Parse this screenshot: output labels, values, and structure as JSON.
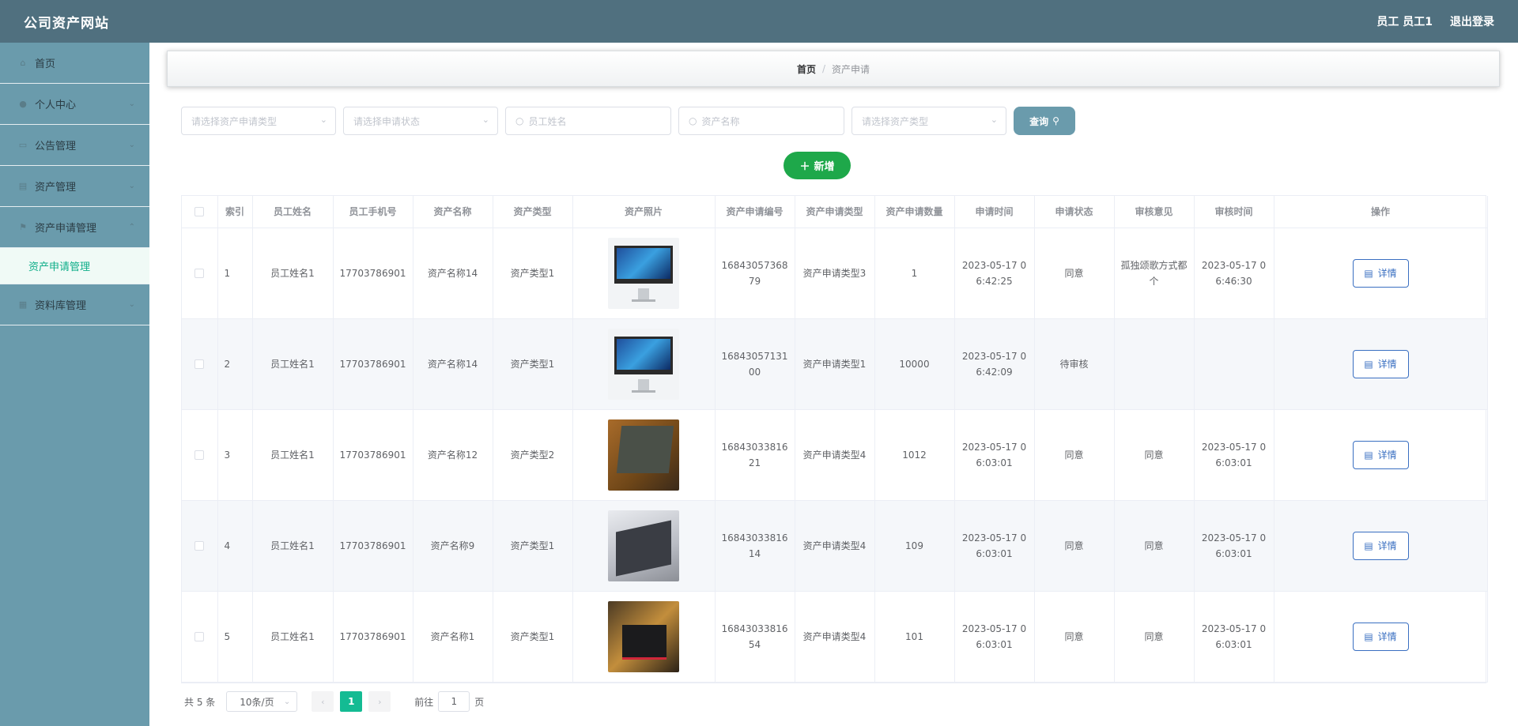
{
  "app": {
    "title": "公司资产网站",
    "user_label": "员工 员工1",
    "logout_label": "退出登录"
  },
  "sidebar": {
    "items": [
      {
        "label": "首页",
        "icon": "home-icon"
      },
      {
        "label": "个人中心",
        "icon": "user-icon"
      },
      {
        "label": "公告管理",
        "icon": "notice-icon"
      },
      {
        "label": "资产管理",
        "icon": "asset-icon"
      },
      {
        "label": "资产申请管理",
        "icon": "apply-icon",
        "expanded": true
      },
      {
        "label": "资料库管理",
        "icon": "library-icon"
      }
    ],
    "submenu_active": "资产申请管理"
  },
  "breadcrumb": {
    "home": "首页",
    "separator": "/",
    "current": "资产申请"
  },
  "filters": {
    "apply_type_placeholder": "请选择资产申请类型",
    "apply_status_placeholder": "请选择申请状态",
    "employee_name_placeholder": "员工姓名",
    "asset_name_placeholder": "资产名称",
    "asset_type_placeholder": "请选择资产类型",
    "query_label": "查询"
  },
  "add_label": "新增",
  "table": {
    "headers": [
      "索引",
      "员工姓名",
      "员工手机号",
      "资产名称",
      "资产类型",
      "资产照片",
      "资产申请编号",
      "资产申请类型",
      "资产申请数量",
      "申请时间",
      "申请状态",
      "审核意见",
      "审核时间",
      "操作"
    ],
    "detail_label": "详情",
    "rows": [
      {
        "index": "1",
        "name": "员工姓名1",
        "phone": "17703786901",
        "asset_name": "资产名称14",
        "asset_type": "资产类型1",
        "photo": "imac",
        "apply_no": "1684305736879",
        "apply_type": "资产申请类型3",
        "qty": "1",
        "apply_time": "2023-05-17 06:42:25",
        "status": "同意",
        "opinion": "孤独颂歌方式都个",
        "review_time": "2023-05-17 06:46:30"
      },
      {
        "index": "2",
        "name": "员工姓名1",
        "phone": "17703786901",
        "asset_name": "资产名称14",
        "asset_type": "资产类型1",
        "photo": "imac",
        "apply_no": "1684305713100",
        "apply_type": "资产申请类型1",
        "qty": "10000",
        "apply_time": "2023-05-17 06:42:09",
        "status": "待审核",
        "opinion": "",
        "review_time": ""
      },
      {
        "index": "3",
        "name": "员工姓名1",
        "phone": "17703786901",
        "asset_name": "资产名称12",
        "asset_type": "资产类型2",
        "photo": "laptop1",
        "apply_no": "1684303381621",
        "apply_type": "资产申请类型4",
        "qty": "1012",
        "apply_time": "2023-05-17 06:03:01",
        "status": "同意",
        "opinion": "同意",
        "review_time": "2023-05-17 06:03:01"
      },
      {
        "index": "4",
        "name": "员工姓名1",
        "phone": "17703786901",
        "asset_name": "资产名称9",
        "asset_type": "资产类型1",
        "photo": "laptop2",
        "apply_no": "1684303381614",
        "apply_type": "资产申请类型4",
        "qty": "109",
        "apply_time": "2023-05-17 06:03:01",
        "status": "同意",
        "opinion": "同意",
        "review_time": "2023-05-17 06:03:01"
      },
      {
        "index": "5",
        "name": "员工姓名1",
        "phone": "17703786901",
        "asset_name": "资产名称1",
        "asset_type": "资产类型1",
        "photo": "laptop3",
        "apply_no": "1684303381654",
        "apply_type": "资产申请类型4",
        "qty": "101",
        "apply_time": "2023-05-17 06:03:01",
        "status": "同意",
        "opinion": "同意",
        "review_time": "2023-05-17 06:03:01"
      }
    ]
  },
  "pagination": {
    "total_label": "共 5 条",
    "page_size": "10条/页",
    "current_page": "1",
    "goto_label": "前往",
    "goto_value": "1",
    "page_suffix": "页"
  }
}
